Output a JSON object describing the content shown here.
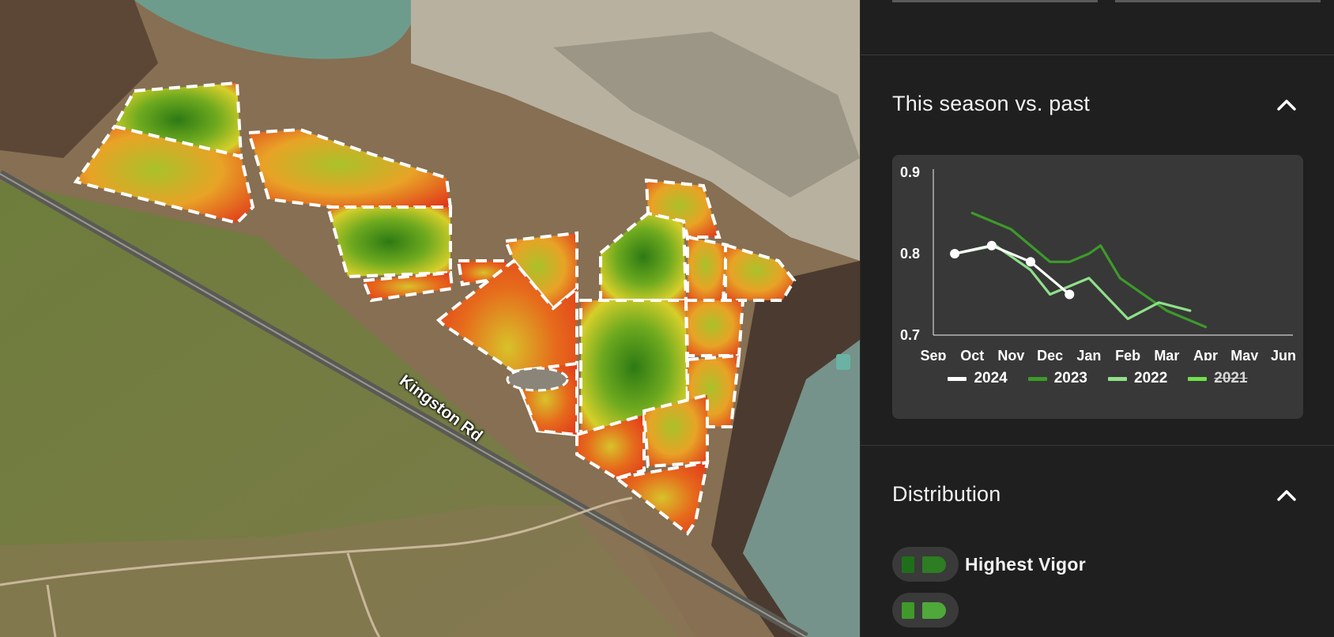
{
  "map": {
    "road_label": "Kingston Rd"
  },
  "panel": {
    "season_section": {
      "title": "This season vs. past",
      "chevron_icon": "chevron-up-icon",
      "expanded": true
    },
    "distribution_section": {
      "title": "Distribution",
      "chevron_icon": "chevron-up-icon",
      "expanded": true,
      "rows": [
        {
          "label": "Highest Vigor",
          "bar_color": "#1f6e19",
          "dome_color": "#2d7d22"
        },
        {
          "label": "",
          "bar_color": "#3f9a2b",
          "dome_color": "#4fa83a"
        }
      ]
    }
  },
  "chart_data": {
    "type": "line",
    "title": "",
    "xlabel": "",
    "ylabel": "",
    "categories": [
      "Sep",
      "Oct",
      "Nov",
      "Dec",
      "Jan",
      "Feb",
      "Mar",
      "Apr",
      "May",
      "Jun"
    ],
    "ylim": [
      0.7,
      0.9
    ],
    "yticks": [
      "0.9",
      "0.8",
      "0.7"
    ],
    "legend_position": "bottom",
    "series": [
      {
        "name": "2024",
        "color": "#ffffff",
        "visible": true,
        "markers": true,
        "points": [
          [
            0.55,
            0.8
          ],
          [
            1.5,
            0.81
          ],
          [
            2.5,
            0.79
          ],
          [
            3.5,
            0.75
          ]
        ]
      },
      {
        "name": "2023",
        "color": "#3d9a2a",
        "visible": true,
        "markers": false,
        "points": [
          [
            1.0,
            0.85
          ],
          [
            2.0,
            0.83
          ],
          [
            3.0,
            0.79
          ],
          [
            3.5,
            0.79
          ],
          [
            4.0,
            0.8
          ],
          [
            4.3,
            0.81
          ],
          [
            4.8,
            0.77
          ],
          [
            6.0,
            0.73
          ],
          [
            7.0,
            0.71
          ]
        ]
      },
      {
        "name": "2022",
        "color": "#8fe08a",
        "visible": true,
        "markers": false,
        "points": [
          [
            0.55,
            0.8
          ],
          [
            1.6,
            0.81
          ],
          [
            2.5,
            0.78
          ],
          [
            3.0,
            0.75
          ],
          [
            4.0,
            0.77
          ],
          [
            5.0,
            0.72
          ],
          [
            5.8,
            0.74
          ],
          [
            6.6,
            0.73
          ]
        ]
      },
      {
        "name": "2021",
        "color": "#6fe04a",
        "visible": false,
        "markers": false,
        "points": []
      }
    ]
  }
}
